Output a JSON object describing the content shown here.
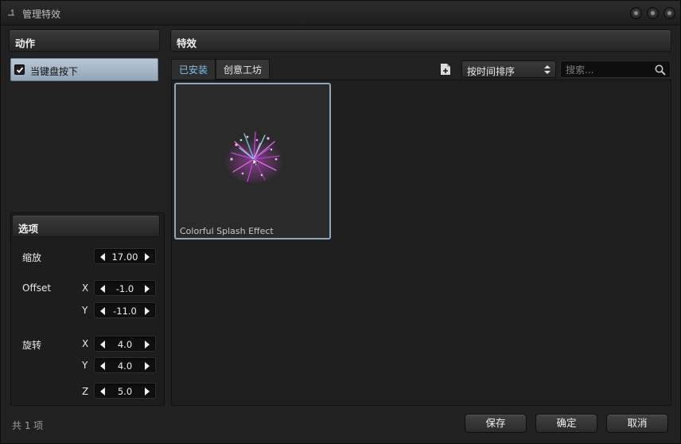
{
  "window": {
    "title": "管理特效"
  },
  "actions_panel": {
    "title": "动作",
    "items": [
      {
        "label": "当键盘按下",
        "checked": true
      }
    ]
  },
  "options_panel": {
    "title": "选项",
    "scale": {
      "label": "缩放",
      "value": "17.00"
    },
    "offset": {
      "label": "Offset",
      "x_label": "X",
      "x": "-1.0",
      "y_label": "Y",
      "y": "-11.0"
    },
    "rotation": {
      "label": "旋转",
      "x_label": "X",
      "x": "4.0",
      "y_label": "Y",
      "y": "4.0",
      "z_label": "Z",
      "z": "5.0"
    }
  },
  "effects_panel": {
    "title": "特效",
    "tabs": [
      {
        "label": "已安装",
        "active": true
      },
      {
        "label": "创意工坊",
        "active": false
      }
    ],
    "sort": {
      "selected": "按时间排序"
    },
    "search": {
      "placeholder": "搜索...",
      "value": ""
    },
    "items": [
      {
        "name": "Colorful Splash Effect",
        "selected": true
      }
    ]
  },
  "footer": {
    "count": "共 1 项",
    "save_label": "保存",
    "ok_label": "确定",
    "cancel_label": "取消"
  },
  "colors": {
    "accent_tab_text": "#7ec3ea",
    "selection_bg": "#a8b9c8",
    "card_border": "#8fa9bb"
  }
}
